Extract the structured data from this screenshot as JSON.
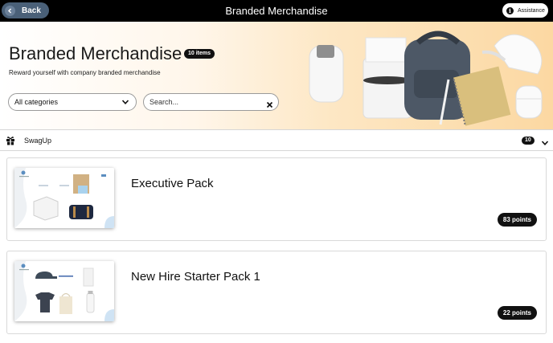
{
  "topbar": {
    "back_label": "Back",
    "title": "Branded Merchandise",
    "assist_label": "Assistance"
  },
  "hero": {
    "title": "Branded Merchandise",
    "count_badge": "10 items",
    "subtitle": "Reward yourself with company branded merchandise"
  },
  "filters": {
    "category_value": "All categories",
    "search_placeholder": "Search..."
  },
  "section": {
    "label": "SwagUp",
    "count": "10"
  },
  "items": [
    {
      "title": "Executive Pack",
      "points": "83 points"
    },
    {
      "title": "New Hire Starter Pack 1",
      "points": "22 points"
    }
  ],
  "icons": {
    "back": "chevron-left-icon",
    "assist": "info-icon",
    "category": "chevron-down-icon",
    "search_clear": "close-icon",
    "section": "gift-icon",
    "section_toggle": "chevron-down-icon"
  },
  "colors": {
    "topbar_bg": "#000000",
    "back_button": "#4a6078",
    "hero_gradient_end": "#fcd8a2",
    "badge": "#111111"
  }
}
